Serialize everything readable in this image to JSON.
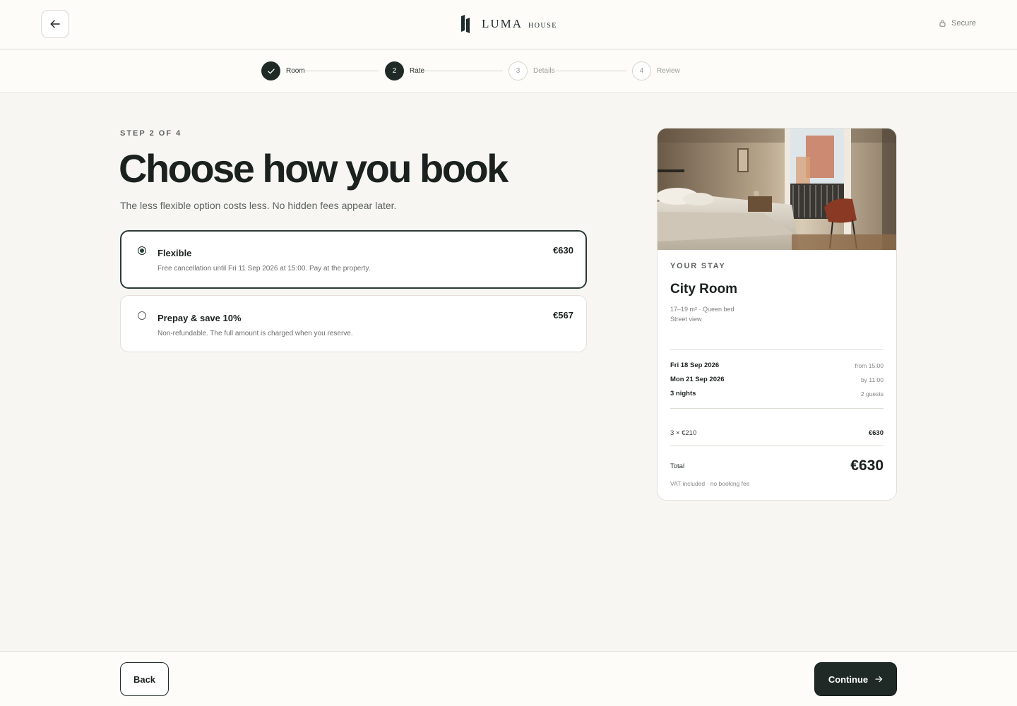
{
  "header": {
    "brand_name": "LUMA",
    "brand_sub": "HOUSE",
    "secure_label": "Secure",
    "icons": {
      "back": "arrow-left-icon",
      "lock": "lock-icon"
    }
  },
  "stepper": {
    "steps": [
      {
        "number": "1",
        "label": "Room",
        "state": "done"
      },
      {
        "number": "2",
        "label": "Rate",
        "state": "active"
      },
      {
        "number": "3",
        "label": "Details",
        "state": "todo"
      },
      {
        "number": "4",
        "label": "Review",
        "state": "todo"
      }
    ]
  },
  "main": {
    "eyebrow": "STEP 2 OF 4",
    "title": "Choose how you book",
    "subtitle": "The less flexible option costs less. No hidden fees appear later.",
    "options": [
      {
        "name": "Flexible",
        "description": "Free cancellation until Fri 11 Sep 2026 at 15:00. Pay at the property.",
        "price": "€630",
        "selected": true
      },
      {
        "name": "Prepay & save 10%",
        "description": "Non-refundable. The full amount is charged when you reserve.",
        "price": "€567",
        "selected": false
      }
    ]
  },
  "summary": {
    "eyebrow": "YOUR STAY",
    "room_name": "City Room",
    "room_size": "17–19 m² · Queen bed",
    "room_view": "Street view",
    "checkin_date": "Fri 18 Sep 2026",
    "checkin_time": "from 15:00",
    "checkout_date": "Mon 21 Sep 2026",
    "checkout_time": "by 11:00",
    "nights": "3 nights",
    "guests": "2 guests",
    "line_label": "3 × €210",
    "line_amount": "€630",
    "total_label": "Total",
    "total_amount": "€630",
    "vat_note": "VAT included · no booking fee"
  },
  "footer": {
    "back_label": "Back",
    "continue_label": "Continue"
  },
  "colors": {
    "primary": "#1f2a27",
    "background": "#f7f6f2",
    "surface": "#ffffff"
  }
}
